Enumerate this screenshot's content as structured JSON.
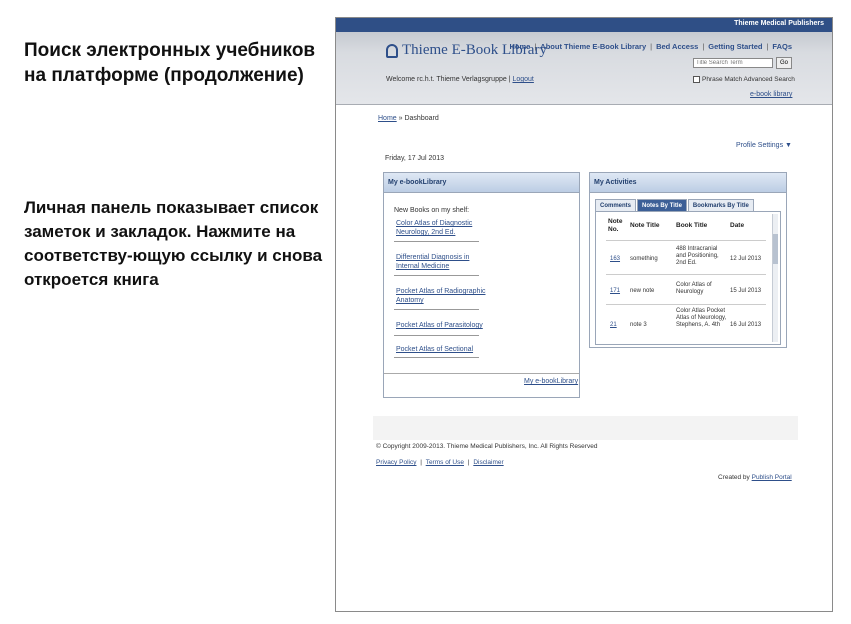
{
  "slide": {
    "title": "Поиск электронных учебников на платформе (продолжение)",
    "body": "Личная панель показывает список заметок и закладок. Нажмите на соответству-ющую ссылку и снова откроется книга"
  },
  "header": {
    "publisher": "Thieme Medical Publishers",
    "logo": "Thieme E-Book Library",
    "nav": [
      "Home",
      "About Thieme E-Book Library",
      "Bed Access",
      "Getting Started",
      "FAQs"
    ],
    "welcome": "Welcome rc.h.t. Thieme Verlagsgruppe",
    "logout": "Logout",
    "search_placeholder": "Title Search Term",
    "search_button": "Go",
    "advanced_search": "Phrase Match Advanced Search",
    "ebook_library_link": "e-book library"
  },
  "breadcrumb": {
    "home": "Home",
    "current": "Dashboard"
  },
  "profile_settings": "Profile Settings",
  "dateline": "Friday, 17 Jul 2013",
  "library_panel": {
    "title": "My e-bookLibrary",
    "subtitle": "New Books on my shelf:",
    "books": [
      "Color Atlas of Diagnostic Neurology, 2nd Ed.",
      "Differential Diagnosis in Internal Medicine",
      "Pocket Atlas of Radiographic Anatomy",
      "Pocket Atlas of Parasitology",
      "Pocket Atlas of Sectional"
    ],
    "my_library_link": "My e-bookLibrary"
  },
  "activities_panel": {
    "title": "My Activities",
    "tabs": [
      "Comments",
      "Notes By Title",
      "Bookmarks By Title"
    ],
    "active_tab": 1,
    "columns": [
      "Note No.",
      "Note Title",
      "Book Title",
      "Date"
    ],
    "rows": [
      {
        "no": "163",
        "note": "something",
        "book": "488 Intracranial and Positioning, 2nd Ed.",
        "date": "12 Jul 2013"
      },
      {
        "no": "171",
        "note": "new note",
        "book": "Color Atlas of Neurology",
        "date": "15 Jul 2013"
      },
      {
        "no": "21",
        "note": "note 3",
        "book": "Color Atlas Pocket Atlas of Neurology, Stephens, A. 4th",
        "date": "16 Jul 2013"
      }
    ]
  },
  "footer": {
    "copyright": "© Copyright 2009-2013. Thieme Medical Publishers, Inc. All Rights Reserved",
    "links": [
      "Privacy Policy",
      "Terms of Use",
      "Disclaimer"
    ],
    "created_by_label": "Created by",
    "created_by_link": "Publish Portal"
  }
}
